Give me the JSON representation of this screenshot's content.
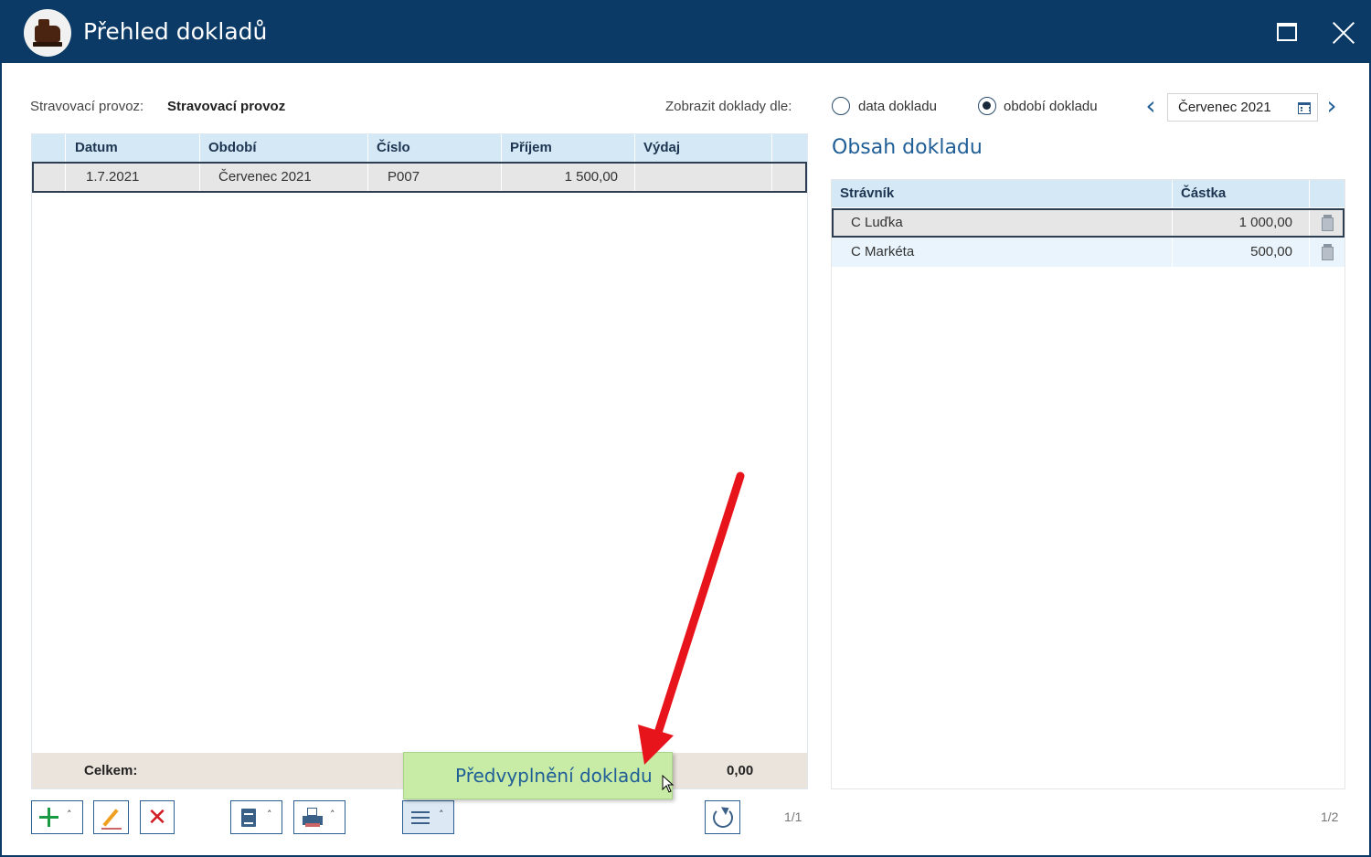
{
  "window": {
    "title": "Přehled dokladů"
  },
  "filter": {
    "provoz_label": "Stravovací provoz:",
    "provoz_value": "Stravovací provoz",
    "show_by_label": "Zobrazit doklady dle:",
    "options": [
      {
        "label": "data dokladu",
        "checked": false
      },
      {
        "label": "období dokladu",
        "checked": true
      }
    ],
    "period": "Červenec 2021"
  },
  "documents": {
    "columns": [
      "Datum",
      "Období",
      "Číslo",
      "Příjem",
      "Výdaj"
    ],
    "rows": [
      {
        "datum": "1.7.2021",
        "obdobi": "Červenec 2021",
        "cislo": "P007",
        "prijem": "1 500,00",
        "vydaj": ""
      }
    ],
    "footer_label": "Celkem:",
    "footer_vydaj": "0,00",
    "pager": "1/1"
  },
  "content": {
    "title": "Obsah dokladu",
    "columns": [
      "Strávník",
      "Částka"
    ],
    "rows": [
      {
        "stravnik": "C Luďka",
        "castka": "1 000,00"
      },
      {
        "stravnik": "C Markéta",
        "castka": "500,00"
      }
    ],
    "pager": "1/2"
  },
  "tooltip": {
    "text": "Předvyplnění dokladu"
  },
  "icons": {
    "add": "plus-icon",
    "edit": "pencil-icon",
    "delete": "x-icon",
    "document": "document-icon",
    "print": "printer-icon",
    "menu": "menu-icon",
    "refresh": "refresh-icon",
    "calendar": "calendar-icon",
    "trash": "trash-icon"
  },
  "colors": {
    "titlebar": "#0b3a66",
    "header": "#d4e8f6",
    "accent": "#1f5e96",
    "tooltip": "#c8eba6",
    "annotation_arrow": "#e8141c"
  }
}
